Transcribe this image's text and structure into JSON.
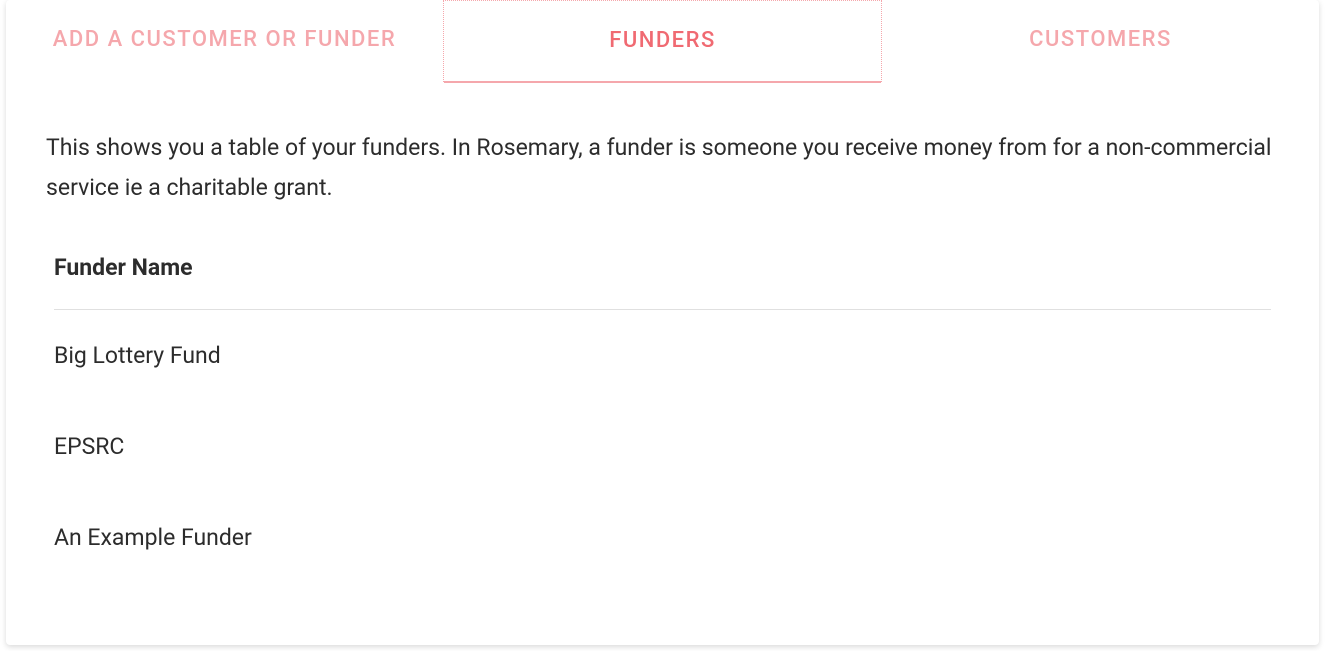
{
  "tabs": {
    "add": {
      "label": "ADD A CUSTOMER OR FUNDER"
    },
    "funders": {
      "label": "FUNDERS"
    },
    "customers": {
      "label": "CUSTOMERS"
    }
  },
  "description": "This shows you a table of your funders. In Rosemary, a funder is someone you receive money from for a non-commercial service ie a charitable grant.",
  "table": {
    "header": "Funder Name",
    "rows": [
      {
        "name": "Big Lottery Fund"
      },
      {
        "name": "EPSRC"
      },
      {
        "name": "An Example Funder"
      }
    ]
  }
}
